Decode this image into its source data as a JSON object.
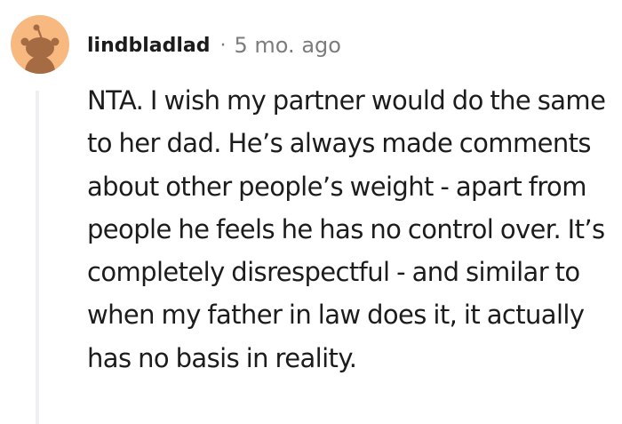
{
  "comment": {
    "author": "lindbladlad",
    "separator": "·",
    "timestamp": "5 mo. ago",
    "avatar_icon": "snoo-avatar-icon",
    "avatar_bg_color": "#f7b980",
    "avatar_fg_color": "#a56b43",
    "body": "NTA. I wish my partner would do the same to her dad. He’s always made comments about other people’s weight - apart from people he feels he has no control over. It’s completely disrespectful - and similar to when my father in law does it, it actually has no basis in reality."
  }
}
